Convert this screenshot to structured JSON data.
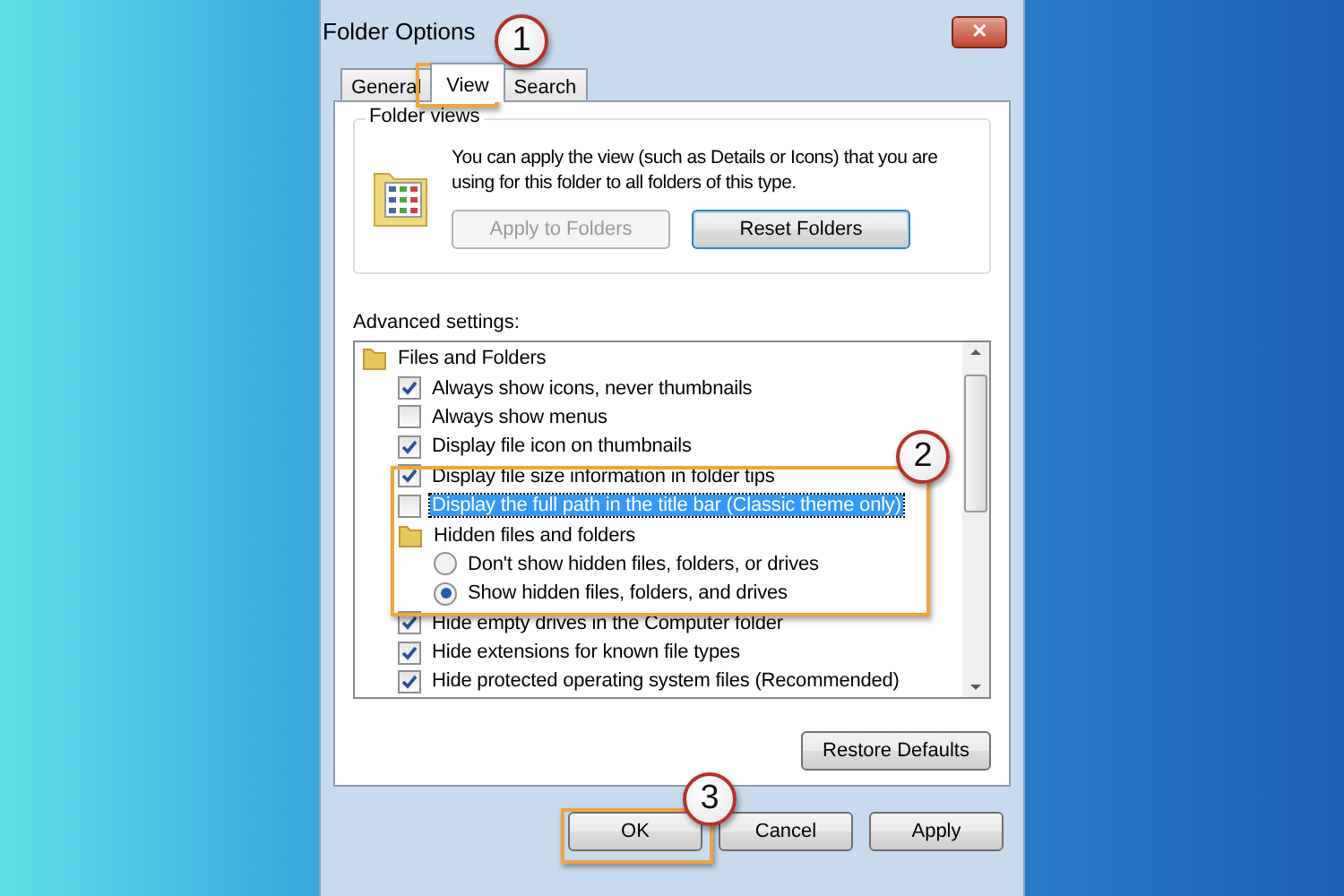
{
  "window": {
    "title": "Folder Options",
    "close": "✕"
  },
  "tabs": [
    {
      "label": "General",
      "selected": false
    },
    {
      "label": "View",
      "selected": true
    },
    {
      "label": "Search",
      "selected": false
    }
  ],
  "folder_views": {
    "title": "Folder views",
    "description": "You can apply the view (such as Details or Icons) that you are using for this folder to all folders of this type.",
    "buttons": [
      {
        "label": "Apply to Folders",
        "disabled": true
      },
      {
        "label": "Reset Folders",
        "disabled": false
      }
    ]
  },
  "advanced": {
    "label": "Advanced settings:",
    "items": [
      {
        "kind": "group",
        "label": "Files and Folders",
        "selected": false,
        "children": [
          {
            "kind": "checkbox",
            "label": "Always show icons, never thumbnails",
            "checked": true,
            "selected": false
          },
          {
            "kind": "checkbox",
            "label": "Always show menus",
            "checked": false,
            "selected": false
          },
          {
            "kind": "checkbox",
            "label": "Display file icon on thumbnails",
            "checked": true,
            "selected": false
          },
          {
            "kind": "checkbox",
            "label": "Display file size information in folder tips",
            "checked": true,
            "selected": false
          },
          {
            "kind": "checkbox",
            "label": "Display the full path in the title bar (Classic theme only)",
            "checked": false,
            "selected": true
          },
          {
            "kind": "group",
            "label": "Hidden files and folders",
            "selected": false,
            "children": [
              {
                "kind": "radio",
                "label": "Don't show hidden files, folders, or drives",
                "checked": false,
                "selected": false
              },
              {
                "kind": "radio",
                "label": "Show hidden files, folders, and drives",
                "checked": true,
                "selected": false
              }
            ]
          },
          {
            "kind": "checkbox",
            "label": "Hide empty drives in the Computer folder",
            "checked": true,
            "selected": false
          },
          {
            "kind": "checkbox",
            "label": "Hide extensions for known file types",
            "checked": true,
            "selected": false
          },
          {
            "kind": "checkbox",
            "label": "Hide protected operating system files (Recommended)",
            "checked": true,
            "selected": false
          }
        ]
      }
    ]
  },
  "restore_button": "Restore Defaults",
  "buttons": [
    {
      "label": "OK"
    },
    {
      "label": "Cancel"
    },
    {
      "label": "Apply"
    }
  ],
  "annotations": [
    {
      "number": "1"
    },
    {
      "number": "2"
    },
    {
      "number": "3"
    }
  ]
}
